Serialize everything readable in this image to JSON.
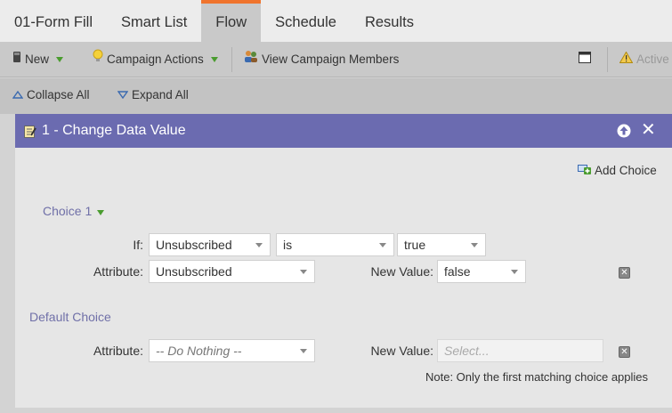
{
  "tabs": [
    {
      "label": "01-Form Fill",
      "active": false
    },
    {
      "label": "Smart List",
      "active": false
    },
    {
      "label": "Flow",
      "active": true
    },
    {
      "label": "Schedule",
      "active": false
    },
    {
      "label": "Results",
      "active": false
    }
  ],
  "toolbar": {
    "new_label": "New",
    "campaign_actions_label": "Campaign Actions",
    "view_members_label": "View Campaign Members",
    "active_label": "Active"
  },
  "collapse": {
    "collapse_all": "Collapse All",
    "expand_all": "Expand All"
  },
  "flow_step": {
    "title": "1 - Change Data Value",
    "add_choice": "Add Choice",
    "choice1": {
      "label": "Choice 1",
      "if_label": "If:",
      "if_field": "Unsubscribed",
      "operator": "is",
      "value": "true",
      "attribute_label": "Attribute:",
      "attribute": "Unsubscribed",
      "new_value_label": "New Value:",
      "new_value": "false"
    },
    "default_choice": {
      "label": "Default Choice",
      "attribute_label": "Attribute:",
      "attribute": "-- Do Nothing --",
      "new_value_label": "New Value:",
      "new_value_placeholder": "Select..."
    },
    "note": "Note: Only the first matching choice applies"
  },
  "colors": {
    "accent_tab": "#f0742d",
    "header_bg": "#6b6bb0",
    "choice_label": "#7070a8"
  }
}
